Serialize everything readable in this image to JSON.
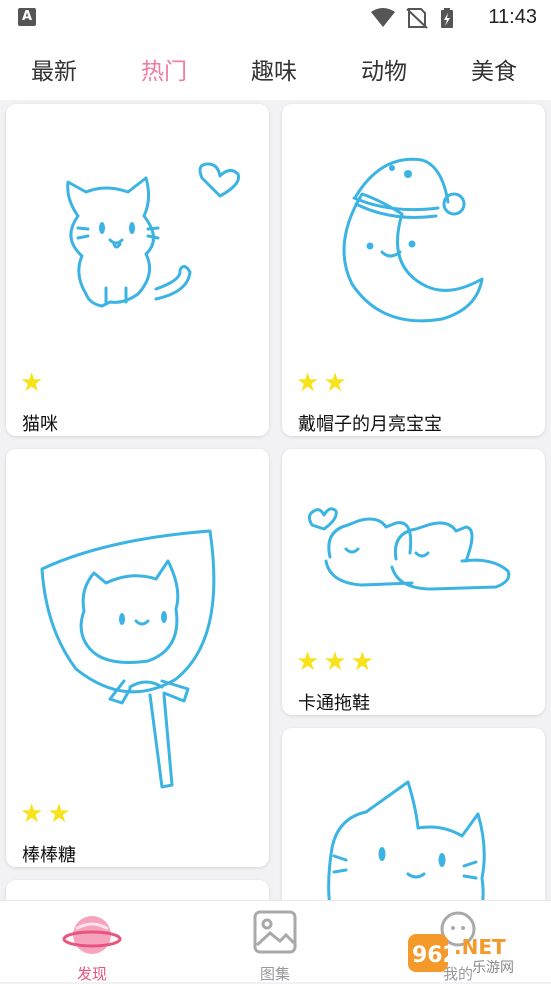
{
  "status_bar": {
    "time": "11:43",
    "icons": [
      "app-a-icon",
      "wifi-icon",
      "no-sim-icon",
      "battery-charging-icon"
    ]
  },
  "tabs": [
    {
      "label": "最新"
    },
    {
      "label": "热门"
    },
    {
      "label": "趣味"
    },
    {
      "label": "动物"
    },
    {
      "label": "美食"
    }
  ],
  "active_tab": "热门",
  "cards": [
    {
      "title": "猫咪",
      "difficulty_stars": 1,
      "icon": "cat-with-heart-drawing"
    },
    {
      "title": "戴帽子的月亮宝宝",
      "difficulty_stars": 2,
      "icon": "moon-with-nightcap-drawing"
    },
    {
      "title": "棒棒糖",
      "difficulty_stars": 2,
      "icon": "cat-lollipop-drawing"
    },
    {
      "title": "卡通拖鞋",
      "difficulty_stars": 3,
      "icon": "cartoon-slippers-drawing"
    },
    {
      "title": "",
      "difficulty_stars": 0,
      "icon": "cat-face-drawing"
    }
  ],
  "bottom_nav": [
    {
      "label": "发现",
      "icon": "planet-icon"
    },
    {
      "label": "图集",
      "icon": "gallery-icon"
    },
    {
      "label": "我的",
      "icon": "profile-icon"
    }
  ],
  "watermark": {
    "text": "962.NET",
    "subtext": "乐游网"
  },
  "colors": {
    "accent": "#f07aa3",
    "line_art": "#3bb3e3",
    "star": "#f7e21c",
    "nav_active": "#e8557f"
  }
}
